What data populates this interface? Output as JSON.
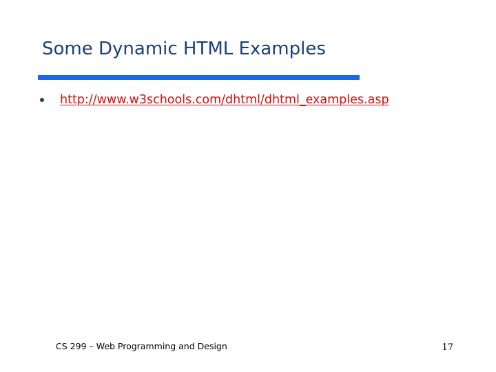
{
  "slide": {
    "title": "Some Dynamic HTML Examples",
    "bullets": [
      {
        "text": "http://www.w3schools.com/dhtml/dhtml_examples.asp"
      }
    ],
    "footer": "CS 299 – Web Programming and Design",
    "page_number": "17"
  },
  "colors": {
    "title_text": "#1a3f7a",
    "title_rule": "#1769e6",
    "bullet": "#1a3f7a",
    "link": "#cc1111",
    "footer_text": "#000000"
  }
}
